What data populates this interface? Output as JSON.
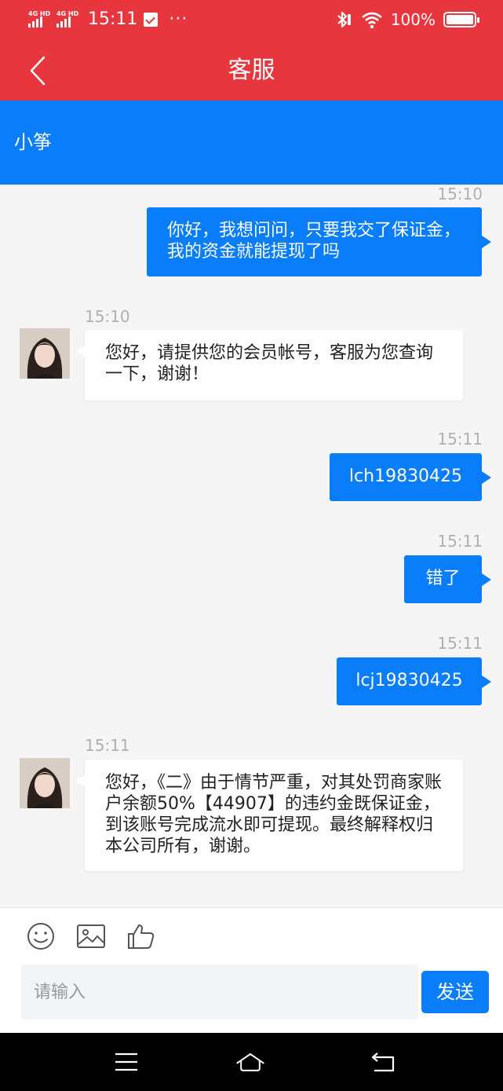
{
  "status_bar": {
    "network1": "4G HD",
    "network2": "4G HD",
    "time": "15:11",
    "dots": "···",
    "battery": "100%",
    "icons": [
      "signal-icon",
      "signal-icon",
      "check-notification-icon",
      "bluetooth-icon",
      "wifi-icon",
      "battery-icon"
    ]
  },
  "navbar": {
    "title": "客服"
  },
  "agent": {
    "name": "小筝"
  },
  "messages": [
    {
      "side": "out",
      "time": "15:10",
      "text": "你好，我想问问，只要我交了保证金，我的资金就能提现了吗"
    },
    {
      "side": "in",
      "time": "15:10",
      "text": "您好，请提供您的会员帐号，客服为您查询一下，谢谢！"
    },
    {
      "side": "out",
      "time": "15:11",
      "text": "lch19830425"
    },
    {
      "side": "out",
      "time": "15:11",
      "text": "错了"
    },
    {
      "side": "out",
      "time": "15:11",
      "text": "lcj19830425"
    },
    {
      "side": "in",
      "time": "15:11",
      "text": "您好，《二》由于情节严重，对其处罚商家账户余额50%【44907】的违约金既保证金，到该账号完成流水即可提现。最终解释权归本公司所有，谢谢。"
    }
  ],
  "input": {
    "placeholder": "请输入",
    "value": ""
  },
  "send_label": "发送",
  "colors": {
    "header": "#e8363f",
    "accent": "#0a7dfa",
    "background": "#f5f5f5"
  }
}
